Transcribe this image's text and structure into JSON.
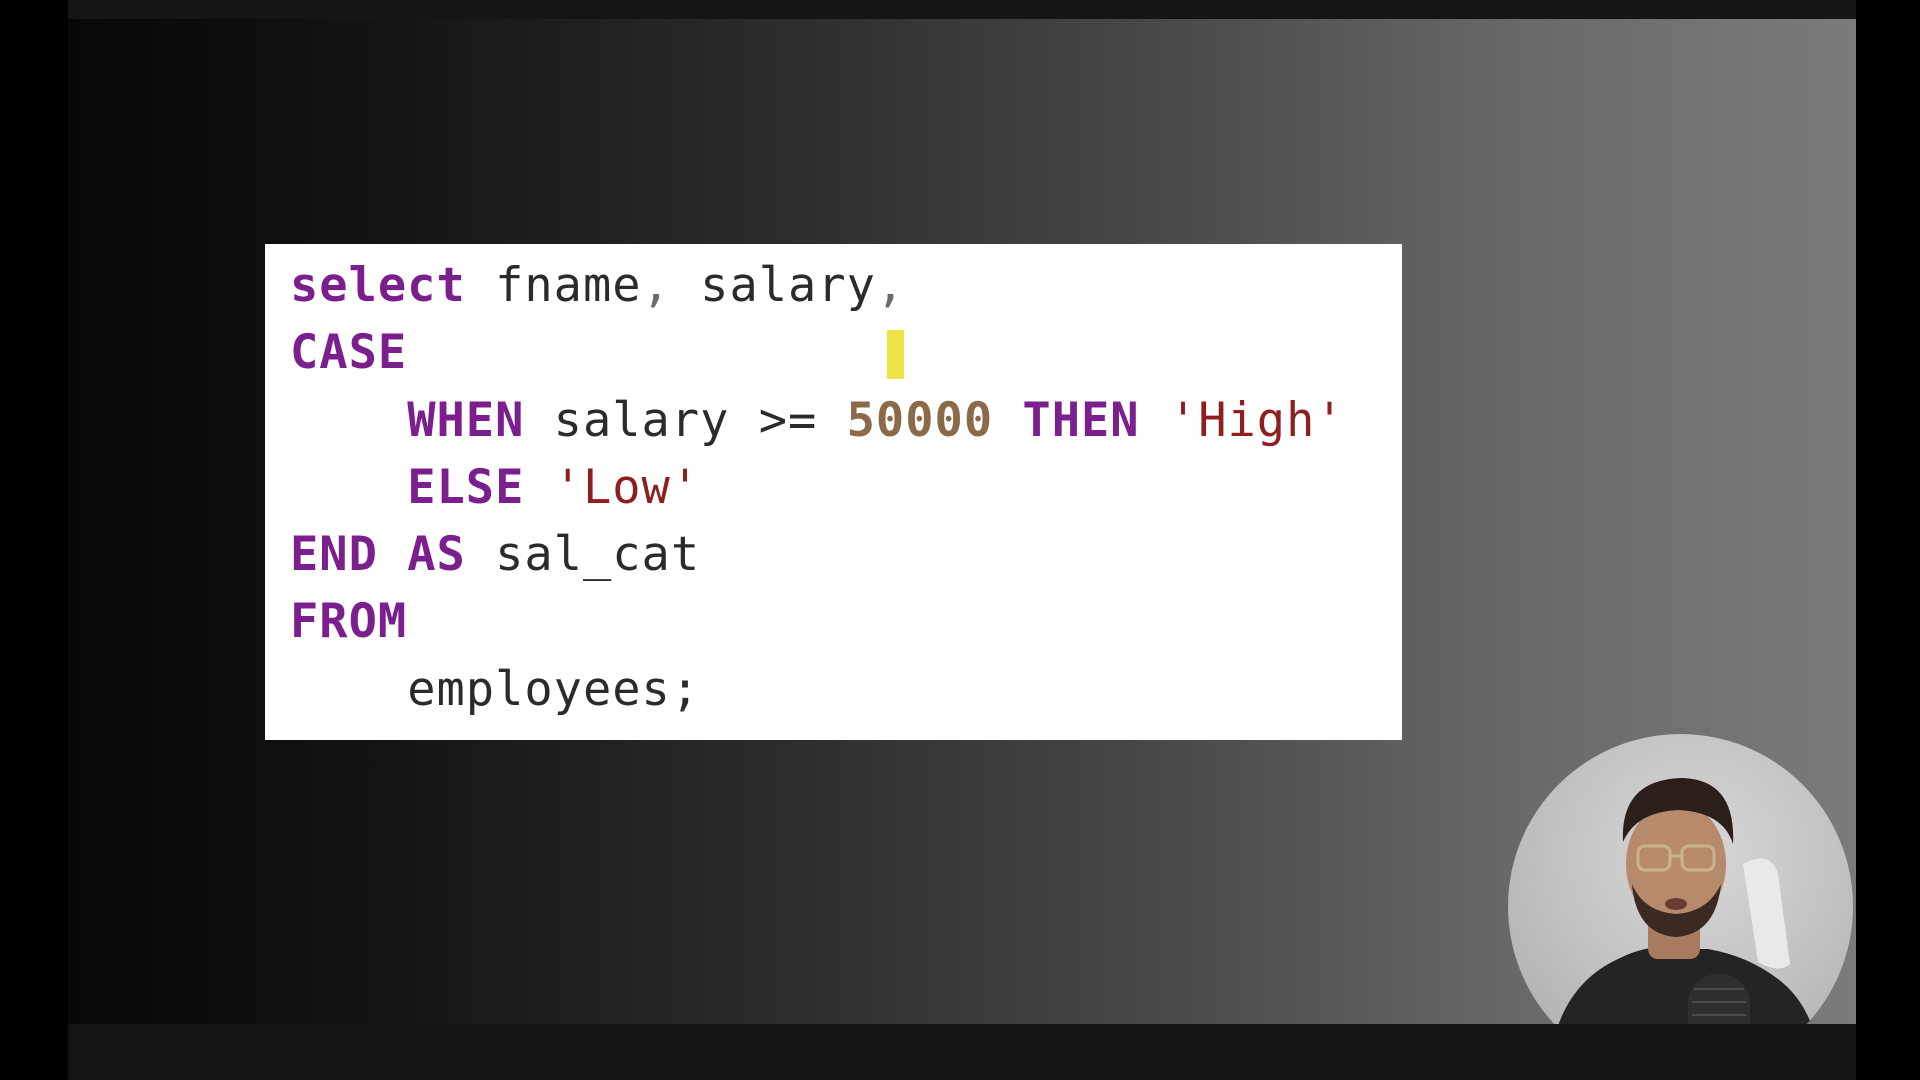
{
  "code": {
    "line1": {
      "kw": "select",
      "ident1": "fname",
      "comma1": ",",
      "ident2": "salary",
      "comma2": ","
    },
    "line2": {
      "kw": "CASE"
    },
    "line3": {
      "indent": "    ",
      "kw1": "WHEN",
      "ident": "salary",
      "op": ">=",
      "num": "50000",
      "kw2": "THEN",
      "str": "'High'"
    },
    "line4": {
      "indent": "    ",
      "kw": "ELSE",
      "str": "'Low'"
    },
    "line5": {
      "kw1": "END",
      "kw2": "AS",
      "ident": "sal_cat"
    },
    "line6": {
      "kw": "FROM"
    },
    "line7": {
      "indent": "    ",
      "ident": "employees;"
    }
  },
  "colors": {
    "keyword": "#7b1f8e",
    "number": "#8a6a48",
    "string": "#8e1f1f",
    "identifier": "#2b2b2b",
    "cursor": "#f0e34a"
  }
}
